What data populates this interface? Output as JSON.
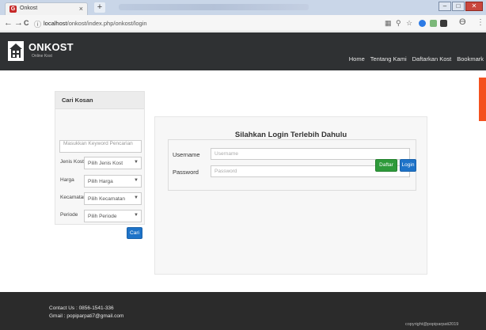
{
  "browser": {
    "tab_title": "Onkost",
    "tab_close": "×",
    "new_tab": "+",
    "back": "←",
    "forward": "→",
    "reload": "C",
    "info": "ⓘ",
    "url_host": "localhost",
    "url_path": "/onkost/index.php/onkost/login",
    "menu": "⋮"
  },
  "header": {
    "brand": "ONKOST",
    "tagline": "Online Kost",
    "nav": [
      "Home",
      "Tentang Kami",
      "Daftarkan Kost",
      "Bookmark"
    ]
  },
  "search": {
    "title": "Cari Kosan",
    "keyword_placeholder": "Masukkan Keyword Pencarian",
    "filters": [
      {
        "label": "Jenis Kost",
        "value": "Pilih Jenis Kost"
      },
      {
        "label": "Harga",
        "value": "Pilih Harga"
      },
      {
        "label": "Kecamatan",
        "value": "Pilih Kecamatan"
      },
      {
        "label": "Periode",
        "value": "Pilih Periode"
      }
    ],
    "button": "Cari"
  },
  "login": {
    "title": "Silahkan Login Terlebih Dahulu",
    "username_label": "Username",
    "username_placeholder": "Username",
    "password_label": "Password",
    "password_placeholder": "Password",
    "register_button": "Daftar",
    "login_button": "Login"
  },
  "footer": {
    "contact": "Contact Us : 0856-1541-336",
    "email": "Gmail : popiparpati7@gmail.com",
    "copyright": "copyright@popiparpati2019"
  },
  "colors": {
    "header_bg": "#2f3133",
    "footer_bg": "#2b2b2b",
    "primary_button": "#1e73c8",
    "success_button": "#2e9a3a",
    "side_tab": "#f4511e"
  }
}
